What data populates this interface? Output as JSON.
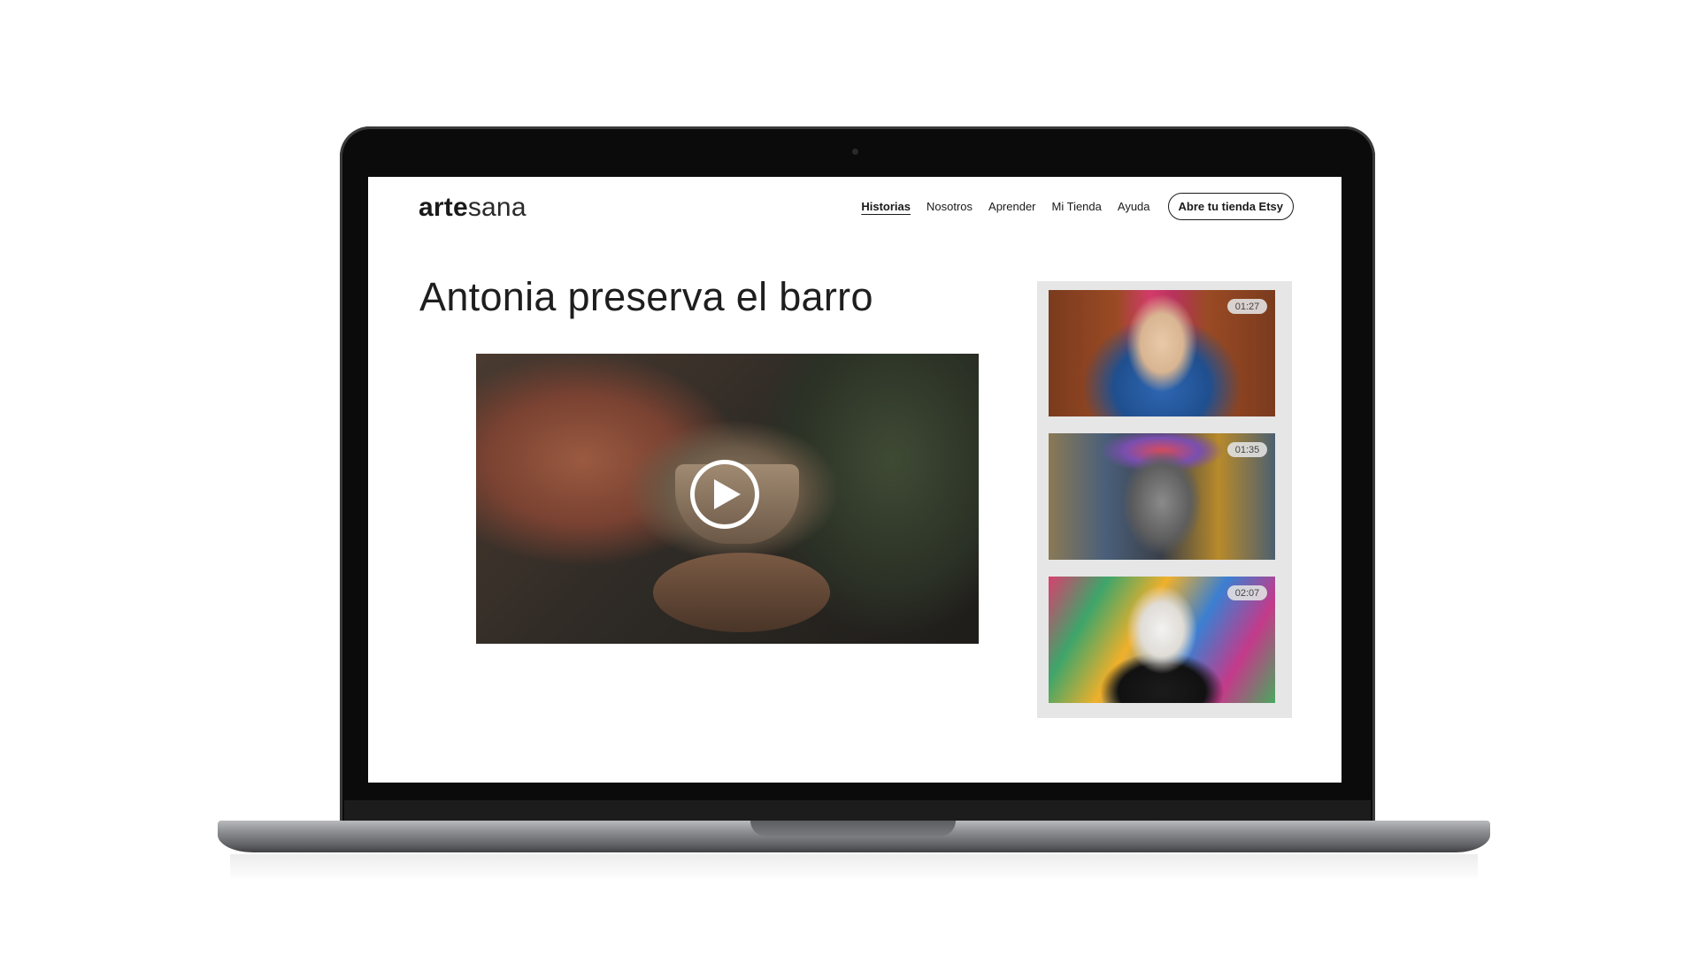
{
  "site": {
    "logo_bold": "arte",
    "logo_light": "sana"
  },
  "nav": {
    "items": [
      "Historias",
      "Nosotros",
      "Aprender",
      "Mi Tienda",
      "Ayuda"
    ],
    "active": "Historias",
    "cta_label": "Abre tu tienda Etsy"
  },
  "main": {
    "title": "Antonia preserva el barro"
  },
  "sidebar": {
    "videos": [
      {
        "duration": "01:27"
      },
      {
        "duration": "01:35"
      },
      {
        "duration": "02:07"
      }
    ]
  },
  "icons": {
    "play": "play-icon"
  },
  "colors": {
    "text": "#1a1a1a",
    "sidebar_bg": "#e6e6e6",
    "device_frame": "#0b0b0b"
  }
}
